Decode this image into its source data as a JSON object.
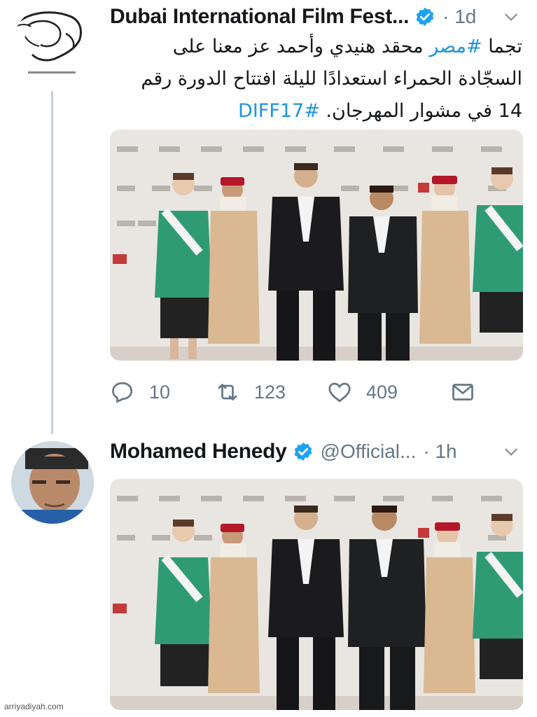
{
  "tweets": [
    {
      "author": "Dubai International Film Fest...",
      "time": "· 1d",
      "text_lines": [
        "تجما #مصر محقد هنيدي وأحمد عز معنا على",
        "السجّادة الحمراء استعدادًا لليلة افتتاح الدورة رقم",
        "14 في مشوار المهرجان. #DIFF17"
      ],
      "text_line1_pre": "تجما ",
      "hashtag1": "#مصر",
      "text_line1_post": " محقد هنيدي وأحمد عز معنا على",
      "text_line2": "السجّادة الحمراء استعدادًا لليلة افتتاح الدورة رقم",
      "text_line3_pre": "14 في مشوار المهرجان. ",
      "hashtag2": "#DIFF17",
      "replies": "10",
      "retweets": "123",
      "likes": "409"
    },
    {
      "author": "Mohamed Henedy",
      "handle": "@Official...",
      "time": "· 1h"
    }
  ],
  "colors": {
    "link": "#1b95e0",
    "verified": "#1da1f2",
    "muted": "#657786"
  },
  "icons": [
    "reply-icon",
    "retweet-icon",
    "like-icon",
    "dm-icon",
    "verified-icon",
    "chevron-down-icon"
  ],
  "watermark": "arriyadiyah.com"
}
